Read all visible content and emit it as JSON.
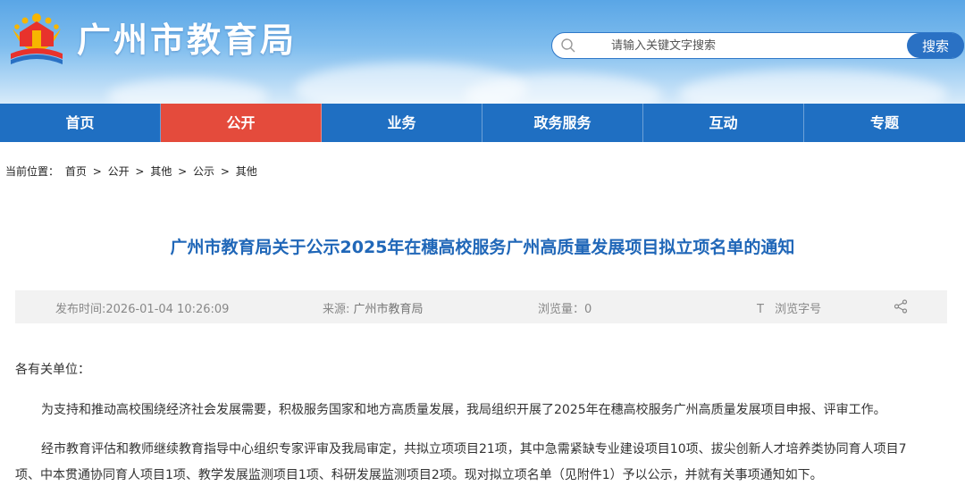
{
  "header": {
    "site_title": "广州市教育局",
    "search": {
      "placeholder": "请输入关键文字搜索",
      "button_label": "搜索"
    }
  },
  "nav": {
    "items": [
      {
        "label": "首页",
        "active": false
      },
      {
        "label": "公开",
        "active": true
      },
      {
        "label": "业务",
        "active": false
      },
      {
        "label": "政务服务",
        "active": false
      },
      {
        "label": "互动",
        "active": false
      },
      {
        "label": "专题",
        "active": false
      }
    ]
  },
  "breadcrumb": {
    "prefix": "当前位置：",
    "items": [
      "首页",
      "公开",
      "其他",
      "公示",
      "其他"
    ],
    "separator": ">"
  },
  "article": {
    "title": "广州市教育局关于公示2025年在穗高校服务广州高质量发展项目拟立项名单的通知",
    "meta": {
      "publish_time": "发布时间:2026-01-04 10:26:09",
      "source_label": "来源: ",
      "source_value": "广州市教育局",
      "views": "浏览量：0",
      "font_size_icon_text": "T",
      "font_size_label": "浏览字号"
    },
    "salutation": "各有关单位：",
    "paragraph_1": "为支持和推动高校围绕经济社会发展需要，积极服务国家和地方高质量发展，我局组织开展了2025年在穗高校服务广州高质量发展项目申报、评审工作。",
    "paragraph_2_line_1": "经市教育评估和教师继续教育指导中心组织专家评审及我局审定，共拟立项项目21项，其中急需紧缺专业建设项目10项、拔尖创新人才培养类协同育人项目7",
    "paragraph_2_line_2": "项、中本贯通协同育人项目1项、教学发展监测项目1项、科研发展监测项目2项。现对拟立项名单（见附件1）予以公示，并就有关事项通知如下。"
  },
  "colors": {
    "nav_bg": "#1f6fc2",
    "nav_active": "#e44b3c",
    "title_blue": "#2067b8",
    "search_button": "#2a71c4"
  },
  "icons": [
    "education-bureau-logo-icon",
    "search-icon",
    "font-size-icon",
    "share-icon"
  ]
}
